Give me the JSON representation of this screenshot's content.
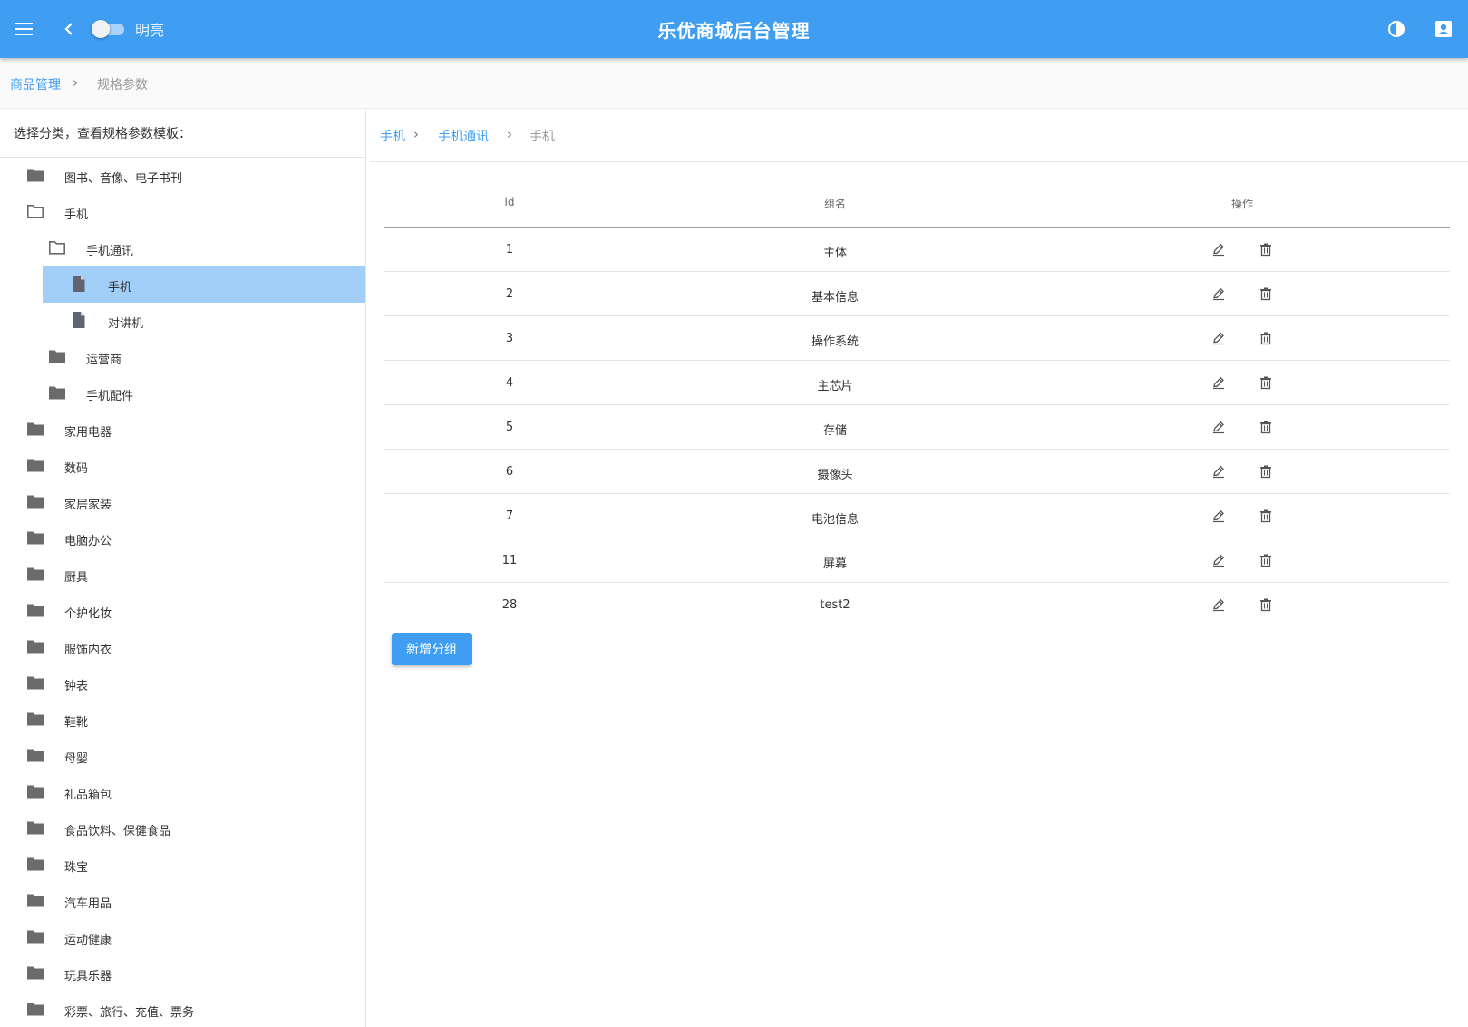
{
  "appbar": {
    "title": "乐优商城后台管理",
    "theme_toggle_label": "明亮",
    "theme_toggle_on": false,
    "icons": {
      "menu": "menu-icon",
      "back": "chevron-left-icon",
      "contrast": "contrast-icon",
      "account": "account-box-icon"
    },
    "color": "#409EF2"
  },
  "breadcrumb": {
    "parent": "商品管理",
    "separator": "›",
    "current": "规格参数"
  },
  "sidebar": {
    "header": "选择分类，查看规格参数模板：",
    "items": [
      {
        "label": "图书、音像、电子书刊",
        "level": 0,
        "icon": "folder-icon"
      },
      {
        "label": "手机",
        "level": 0,
        "icon": "folder-open-icon"
      },
      {
        "label": "手机通讯",
        "level": 1,
        "icon": "folder-open-icon"
      },
      {
        "label": "手机",
        "level": 2,
        "icon": "file-icon",
        "selected": true
      },
      {
        "label": "对讲机",
        "level": 2,
        "icon": "file-icon"
      },
      {
        "label": "运营商",
        "level": 1,
        "icon": "folder-icon"
      },
      {
        "label": "手机配件",
        "level": 1,
        "icon": "folder-icon"
      },
      {
        "label": "家用电器",
        "level": 0,
        "icon": "folder-icon"
      },
      {
        "label": "数码",
        "level": 0,
        "icon": "folder-icon"
      },
      {
        "label": "家居家装",
        "level": 0,
        "icon": "folder-icon"
      },
      {
        "label": "电脑办公",
        "level": 0,
        "icon": "folder-icon"
      },
      {
        "label": "厨具",
        "level": 0,
        "icon": "folder-icon"
      },
      {
        "label": "个护化妆",
        "level": 0,
        "icon": "folder-icon"
      },
      {
        "label": "服饰内衣",
        "level": 0,
        "icon": "folder-icon"
      },
      {
        "label": "钟表",
        "level": 0,
        "icon": "folder-icon"
      },
      {
        "label": "鞋靴",
        "level": 0,
        "icon": "folder-icon"
      },
      {
        "label": "母婴",
        "level": 0,
        "icon": "folder-icon"
      },
      {
        "label": "礼品箱包",
        "level": 0,
        "icon": "folder-icon"
      },
      {
        "label": "食品饮料、保健食品",
        "level": 0,
        "icon": "folder-icon"
      },
      {
        "label": "珠宝",
        "level": 0,
        "icon": "folder-icon"
      },
      {
        "label": "汽车用品",
        "level": 0,
        "icon": "folder-icon"
      },
      {
        "label": "运动健康",
        "level": 0,
        "icon": "folder-icon"
      },
      {
        "label": "玩具乐器",
        "level": 0,
        "icon": "folder-icon"
      },
      {
        "label": "彩票、旅行、充值、票务",
        "level": 0,
        "icon": "folder-icon"
      }
    ]
  },
  "panel": {
    "path": [
      "手机",
      "手机通讯",
      "手机"
    ],
    "separator": "›",
    "table": {
      "headers": {
        "id": "id",
        "name": "组名",
        "actions": "操作"
      },
      "rows": [
        {
          "id": "1",
          "name": "主体"
        },
        {
          "id": "2",
          "name": "基本信息"
        },
        {
          "id": "3",
          "name": "操作系统"
        },
        {
          "id": "4",
          "name": "主芯片"
        },
        {
          "id": "5",
          "name": "存储"
        },
        {
          "id": "6",
          "name": "摄像头"
        },
        {
          "id": "7",
          "name": "电池信息"
        },
        {
          "id": "11",
          "name": "屏幕"
        },
        {
          "id": "28",
          "name": "test2"
        }
      ],
      "row_actions": [
        "edit-icon",
        "delete-icon"
      ]
    },
    "add_button_label": "新增分组"
  }
}
